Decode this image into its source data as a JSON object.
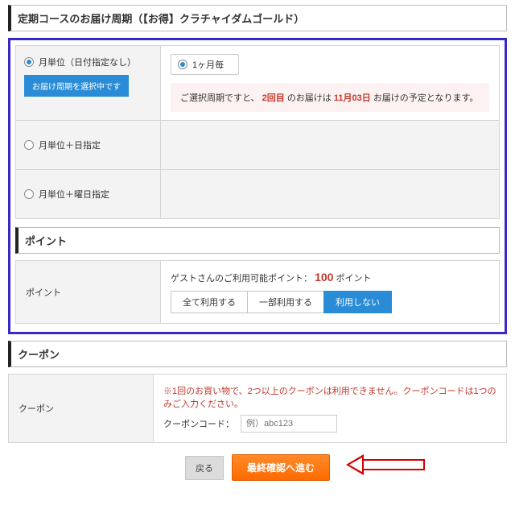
{
  "titles": {
    "delivery_cycle": "定期コースのお届け周期（【お得】クラチャイダムゴールド）",
    "points": "ポイント",
    "coupon": "クーポン"
  },
  "delivery": {
    "options": {
      "monthly_no_date": "月単位（日付指定なし）",
      "monthly_with_date": "月単位＋日指定",
      "monthly_with_weekday": "月単位＋曜日指定"
    },
    "selecting_badge": "お届け周期を選択中です",
    "interval_label": "1ヶ月毎",
    "notice_prefix": "ご選択周期ですと、",
    "notice_mid1": "2回目",
    "notice_mid2": "のお届けは",
    "notice_date": "11月03日",
    "notice_suffix": "お届けの予定となります。"
  },
  "points": {
    "left_label": "ポイント",
    "line_prefix": "ゲストさんのご利用可能ポイント：",
    "line_value": "100",
    "line_suffix": "ポイント",
    "btn_all": "全て利用する",
    "btn_partial": "一部利用する",
    "btn_none": "利用しない"
  },
  "coupon": {
    "left_label": "クーポン",
    "note": "※1回のお買い物で、2つ以上のクーポンは利用できません。クーポンコードは1つのみご入力ください。",
    "code_label": "クーポンコード：",
    "placeholder": "例）abc123"
  },
  "buttons": {
    "back": "戻る",
    "next": "最終確認へ進む"
  }
}
